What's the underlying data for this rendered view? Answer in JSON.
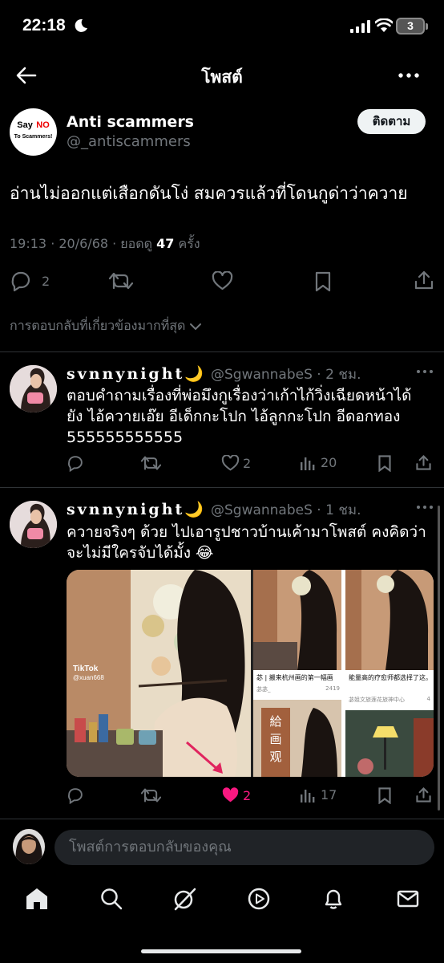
{
  "status_bar": {
    "time": "22:18",
    "battery": "3"
  },
  "header": {
    "title": "โพสต์"
  },
  "main_post": {
    "author_name": "Anti scammers",
    "author_handle": "@_antiscammers",
    "avatar_text_1": "Say",
    "avatar_text_2": "NO",
    "avatar_text_3": "To Scammers!",
    "follow_label": "ติดตาม",
    "text": "อ่านไม่ออกแต่เสือกดันโง่ สมควรแล้วที่โดนกูด่าว่าควาย",
    "timestamp": "19:13 · 20/6/68 · ยอดดู ",
    "views": "47",
    "views_suffix": " ครั้ง",
    "reply_count": "2"
  },
  "replies_sort": {
    "label": "การตอบกลับที่เกี่ยวข้องมากที่สุด"
  },
  "replies": [
    {
      "name": "svnnynight🌙",
      "handle_time": "@SgwannabeS · 2 ชม.",
      "text": "ตอบคำถามเรื่องที่พ่อมึงกูเรื่องว่าเก้าไก้วิ่งเฉียดหน้าได้ยัง ไอ้ควายเอ๊ย อีเด็กกะโปก ไอ้ลูกกะโปก อีดอกทอง 555555555555",
      "likes": "2",
      "views": "20"
    },
    {
      "name": "svnnynight🌙",
      "handle_time": "@SgwannabeS · 1 ชม.",
      "text": "ควายจริงๆ ด้วย ไปเอารูปชาวบ้านเค้ามาโพสต์ คงคิดว่าจะไม่มีใครจับได้มั้ง 😂",
      "likes": "2",
      "views": "17",
      "media": {
        "tiktok_label": "TikTok",
        "tiktok_user": "@xuan668",
        "card1_text": "苾 | 搬来杭州画的第一幅画",
        "card1_user": "苾苾_",
        "card1_likes": "2419",
        "card2_text": "能量高的疗愈师都选择了这。",
        "card2_user": "苾姐文旅莲花旅神中心",
        "card2_likes": "4",
        "card3_text": "給 画 观"
      }
    }
  ],
  "compose": {
    "placeholder": "โพสต์การตอบกลับของคุณ"
  },
  "colors": {
    "accent_like": "#f91880",
    "muted": "#71767b",
    "background": "#000000"
  }
}
